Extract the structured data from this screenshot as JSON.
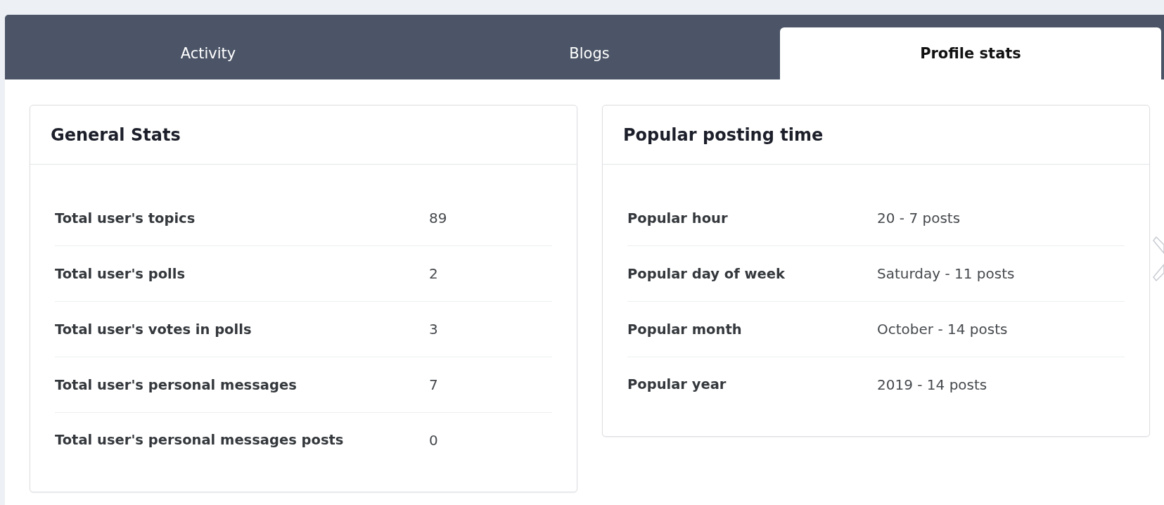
{
  "tabs": [
    {
      "label": "Activity",
      "selected": false
    },
    {
      "label": "Blogs",
      "selected": false
    },
    {
      "label": "Profile stats",
      "selected": true
    }
  ],
  "cards": [
    {
      "title": "General Stats",
      "rows": [
        {
          "label": "Total user's topics",
          "value": "89"
        },
        {
          "label": "Total user's polls",
          "value": "2"
        },
        {
          "label": "Total user's votes in polls",
          "value": "3"
        },
        {
          "label": "Total user's personal messages",
          "value": "7"
        },
        {
          "label": "Total user's personal messages posts",
          "value": "0"
        }
      ]
    },
    {
      "title": "Popular posting time",
      "rows": [
        {
          "label": "Popular hour",
          "value": "20 - 7 posts"
        },
        {
          "label": "Popular day of week",
          "value": "Saturday - 11 posts"
        },
        {
          "label": "Popular month",
          "value": "October - 14 posts"
        },
        {
          "label": "Popular year",
          "value": "2019 - 14 posts"
        }
      ]
    }
  ]
}
